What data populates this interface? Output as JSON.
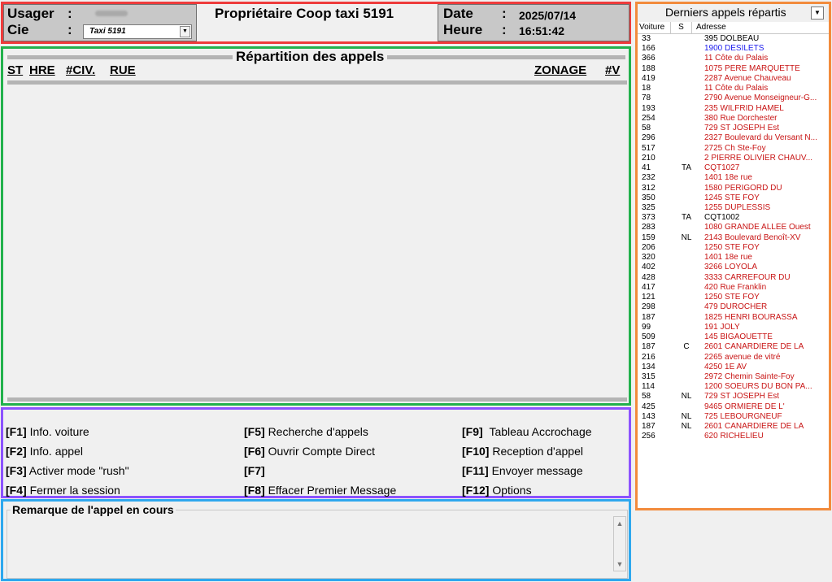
{
  "header": {
    "usager_label": "Usager",
    "cie_label": "Cie",
    "colon": ":",
    "cie_value": "Taxi 5191",
    "title": "Propriétaire Coop taxi 5191",
    "date_label": "Date",
    "heure_label": "Heure",
    "date_value": "2025/07/14",
    "heure_value": "16:51:42"
  },
  "dispatch": {
    "title": "Répartition des appels",
    "columns": [
      "ST",
      "HRE",
      "#CIV.",
      "RUE",
      "ZONAGE",
      "#V"
    ]
  },
  "fkeys": [
    {
      "key": "[F1]",
      "label": "Info. voiture"
    },
    {
      "key": "[F2]",
      "label": "Info. appel"
    },
    {
      "key": "[F3]",
      "label": "Activer mode \"rush\""
    },
    {
      "key": "[F4]",
      "label": "Fermer la session"
    },
    {
      "key": "[F5]",
      "label": "Recherche d'appels"
    },
    {
      "key": "[F6]",
      "label": "Ouvrir Compte Direct"
    },
    {
      "key": "[F7]",
      "label": ""
    },
    {
      "key": "[F8]",
      "label": "Effacer Premier Message"
    },
    {
      "key": "[F9]",
      "label": "Tableau Accrochage"
    },
    {
      "key": "[F10]",
      "label": "Reception d'appel"
    },
    {
      "key": "[F11]",
      "label": "Envoyer message"
    },
    {
      "key": "[F12]",
      "label": "Options"
    }
  ],
  "remark": {
    "title": "Remarque de l'appel en cours"
  },
  "recent_calls": {
    "title": "Derniers appels répartis",
    "columns": [
      "Voiture",
      "S",
      "Adresse"
    ],
    "colors": {
      "black": "#000000",
      "blue": "#1a1aee",
      "red": "#c81414"
    },
    "rows": [
      {
        "car": "33",
        "s": "",
        "address": "395 DOLBEAU",
        "color": "black"
      },
      {
        "car": "166",
        "s": "",
        "address": "1900 DÉSILETS",
        "color": "blue"
      },
      {
        "car": "366",
        "s": "",
        "address": "11 Côte du Palais",
        "color": "red"
      },
      {
        "car": "188",
        "s": "",
        "address": "1075 PÈRE MARQUETTE",
        "color": "red"
      },
      {
        "car": "419",
        "s": "",
        "address": "2287 Avenue Chauveau",
        "color": "red"
      },
      {
        "car": "18",
        "s": "",
        "address": "11 Côte du Palais",
        "color": "red"
      },
      {
        "car": "78",
        "s": "",
        "address": "2790 Avenue Monseigneur-G...",
        "color": "red"
      },
      {
        "car": "193",
        "s": "",
        "address": "235 WILFRID HAMEL",
        "color": "red"
      },
      {
        "car": "254",
        "s": "",
        "address": "380 Rue Dorchester",
        "color": "red"
      },
      {
        "car": "58",
        "s": "",
        "address": "729 ST JOSEPH Est",
        "color": "red"
      },
      {
        "car": "296",
        "s": "",
        "address": "2327 Boulevard du Versant N...",
        "color": "red"
      },
      {
        "car": "517",
        "s": "",
        "address": "2725 Ch Ste-Foy",
        "color": "red"
      },
      {
        "car": "210",
        "s": "",
        "address": "2 PIERRE OLIVIER CHAUV...",
        "color": "red"
      },
      {
        "car": "41",
        "s": "TA",
        "address": "CQT1027",
        "color": "red"
      },
      {
        "car": "232",
        "s": "",
        "address": "1401 18e rue",
        "color": "red"
      },
      {
        "car": "312",
        "s": "",
        "address": "1580 PÉRIGORD DU",
        "color": "red"
      },
      {
        "car": "350",
        "s": "",
        "address": "1245 STE FOY",
        "color": "red"
      },
      {
        "car": "325",
        "s": "",
        "address": "1255 DUPLESSIS",
        "color": "red"
      },
      {
        "car": "373",
        "s": "TA",
        "address": "CQT1002",
        "color": "black"
      },
      {
        "car": "283",
        "s": "",
        "address": "1080 GRANDE ALLÉE Ouest",
        "color": "red"
      },
      {
        "car": "159",
        "s": "NL",
        "address": "2143 Boulevard Benoît-XV",
        "color": "red"
      },
      {
        "car": "206",
        "s": "",
        "address": "1250 STE FOY",
        "color": "red"
      },
      {
        "car": "320",
        "s": "",
        "address": "1401 18e rue",
        "color": "red"
      },
      {
        "car": "402",
        "s": "",
        "address": "3266 LOYOLA",
        "color": "red"
      },
      {
        "car": "428",
        "s": "",
        "address": "3333 CARREFOUR DU",
        "color": "red"
      },
      {
        "car": "417",
        "s": "",
        "address": "420 Rue Franklin",
        "color": "red"
      },
      {
        "car": "121",
        "s": "",
        "address": "1250 STE FOY",
        "color": "red"
      },
      {
        "car": "298",
        "s": "",
        "address": "479 DUROCHER",
        "color": "red"
      },
      {
        "car": "187",
        "s": "",
        "address": "1825 HENRI BOURASSA",
        "color": "red"
      },
      {
        "car": "99",
        "s": "",
        "address": "191 JOLY",
        "color": "red"
      },
      {
        "car": "509",
        "s": "",
        "address": "145 BIGAOUETTE",
        "color": "red"
      },
      {
        "car": "187",
        "s": "C",
        "address": "2601 CANARDIÈRE DE LA",
        "color": "red"
      },
      {
        "car": "216",
        "s": "",
        "address": "2265 avenue de vitré",
        "color": "red"
      },
      {
        "car": "134",
        "s": "",
        "address": "4250 1E AV",
        "color": "red"
      },
      {
        "car": "315",
        "s": "",
        "address": "2972 Chemin Sainte-Foy",
        "color": "red"
      },
      {
        "car": "114",
        "s": "",
        "address": "1200 SOEURS DU BON PA...",
        "color": "red"
      },
      {
        "car": "58",
        "s": "NL",
        "address": "729 ST JOSEPH Est",
        "color": "red"
      },
      {
        "car": "425",
        "s": "",
        "address": "9465 ORMIÈRE DE L'",
        "color": "red"
      },
      {
        "car": "143",
        "s": "NL",
        "address": "725 LEBOURGNEUF",
        "color": "red"
      },
      {
        "car": "187",
        "s": "NL",
        "address": "2601 CANARDIÈRE DE LA",
        "color": "red"
      },
      {
        "car": "256",
        "s": "",
        "address": "620 RICHELIEU",
        "color": "red"
      }
    ]
  }
}
